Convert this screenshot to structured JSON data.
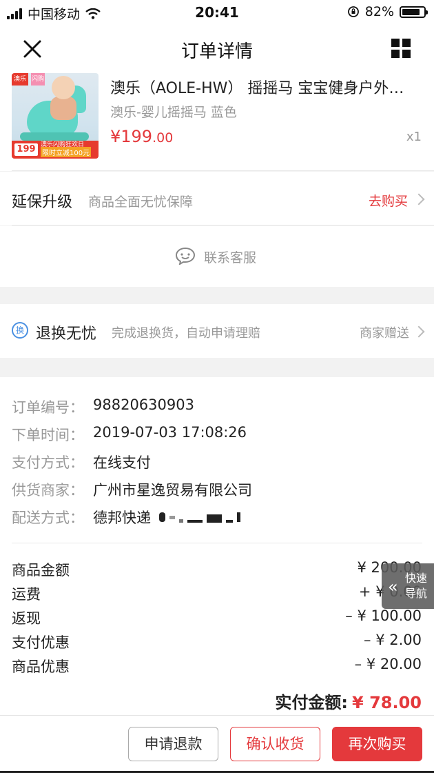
{
  "status_bar": {
    "carrier": "中国移动",
    "time": "20:41",
    "battery": "82%",
    "battery_level": 0.82
  },
  "nav": {
    "title": "订单详情"
  },
  "product": {
    "title": "澳乐（AOLE-HW） 摇摇马 宝宝健身户外室内儿童玩具",
    "spec": "澳乐-婴儿摇摇马 蓝色",
    "price_int": "¥199",
    "price_dec": ".00",
    "qty": "x1",
    "thumb": {
      "brand_badge": "澳乐",
      "flash_badge": "闪购",
      "price_tag": "199",
      "promo_sub": "澳乐闪购狂欢日",
      "promo": "限时立减100元"
    }
  },
  "warranty": {
    "label": "延保升级",
    "desc": "商品全面无忧保障",
    "action": "去购买"
  },
  "service": {
    "label": "联系客服"
  },
  "return_service": {
    "icon_text": "换",
    "label": "退换无忧",
    "desc": "完成退换货，自动申请理赔",
    "action": "商家赠送"
  },
  "order_info": [
    {
      "key": "订单编号：",
      "value": "98820630903"
    },
    {
      "key": "下单时间：",
      "value": "2019-07-03 17:08:26"
    },
    {
      "key": "支付方式：",
      "value": "在线支付"
    },
    {
      "key": "供货商家：",
      "value": "广州市星逸贸易有限公司"
    },
    {
      "key": "配送方式：",
      "value": "德邦快递"
    }
  ],
  "fees": [
    {
      "label": "商品金额",
      "value": "¥ 200.00"
    },
    {
      "label": "运费",
      "value": "+ ¥ 0.00"
    },
    {
      "label": "返现",
      "value": "– ¥ 100.00"
    },
    {
      "label": "支付优惠",
      "value": "– ¥ 2.00"
    },
    {
      "label": "商品优惠",
      "value": "– ¥ 20.00"
    }
  ],
  "total": {
    "label": "实付金额:",
    "value": "¥ 78.00"
  },
  "quick_nav": {
    "label": "快速导航"
  },
  "buttons": {
    "refund": "申请退款",
    "confirm": "确认收货",
    "rebuy": "再次购买"
  },
  "colors": {
    "accent": "#e4393c",
    "info_icon": "#4a90e2"
  }
}
